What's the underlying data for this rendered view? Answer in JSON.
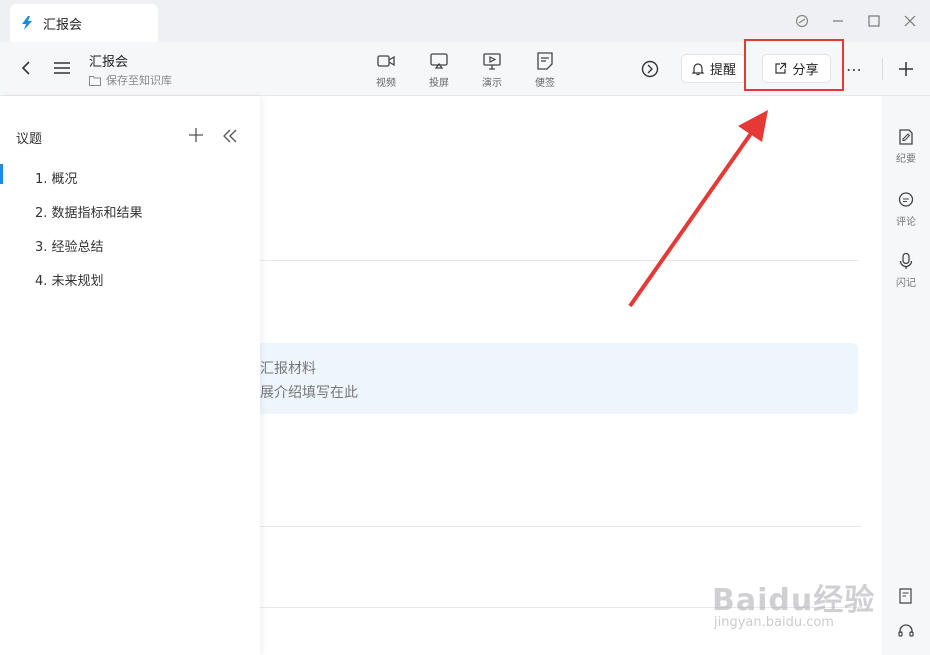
{
  "window": {
    "tab_title": "汇报会"
  },
  "toolbar": {
    "doc_title": "汇报会",
    "doc_sub": "保存至知识库",
    "tools": [
      {
        "label": "视频"
      },
      {
        "label": "投屏"
      },
      {
        "label": "演示"
      },
      {
        "label": "便签"
      }
    ],
    "remind_label": "提醒",
    "share_label": "分享"
  },
  "sidebar": {
    "heading": "议题",
    "items": [
      {
        "label": "1. 概况"
      },
      {
        "label": "2. 数据指标和结果"
      },
      {
        "label": "3. 经验总结"
      },
      {
        "label": "4. 未来规划"
      }
    ]
  },
  "main": {
    "info_line1": "汇报材料",
    "info_line2": "展介绍填写在此"
  },
  "right_panel": {
    "items": [
      {
        "label": "纪要"
      },
      {
        "label": "评论"
      },
      {
        "label": "闪记"
      }
    ]
  },
  "watermark": {
    "text": "Baidu经验",
    "sub": "jingyan.baidu.com"
  },
  "colors": {
    "accent": "#1e88e5",
    "highlight": "#e53935",
    "arrow": "#e53935"
  }
}
